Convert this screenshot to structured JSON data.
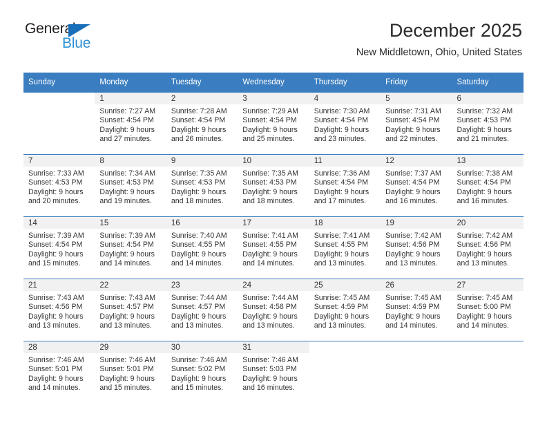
{
  "logo": {
    "word_one": "General",
    "word_two": "Blue",
    "triangle_color": "#1a6fba",
    "blue_text_color": "#2d8fd5"
  },
  "header": {
    "title": "December 2025",
    "subtitle": "New Middletown, Ohio, United States"
  },
  "theme": {
    "header_blue": "#3a7dc0",
    "daynum_band": "#f1f1f1",
    "text": "#333333"
  },
  "calendar": {
    "weekdays": [
      "Sunday",
      "Monday",
      "Tuesday",
      "Wednesday",
      "Thursday",
      "Friday",
      "Saturday"
    ],
    "weeks": [
      [
        {
          "day": "",
          "lines": []
        },
        {
          "day": "1",
          "lines": [
            "Sunrise: 7:27 AM",
            "Sunset: 4:54 PM",
            "Daylight: 9 hours",
            "and 27 minutes."
          ]
        },
        {
          "day": "2",
          "lines": [
            "Sunrise: 7:28 AM",
            "Sunset: 4:54 PM",
            "Daylight: 9 hours",
            "and 26 minutes."
          ]
        },
        {
          "day": "3",
          "lines": [
            "Sunrise: 7:29 AM",
            "Sunset: 4:54 PM",
            "Daylight: 9 hours",
            "and 25 minutes."
          ]
        },
        {
          "day": "4",
          "lines": [
            "Sunrise: 7:30 AM",
            "Sunset: 4:54 PM",
            "Daylight: 9 hours",
            "and 23 minutes."
          ]
        },
        {
          "day": "5",
          "lines": [
            "Sunrise: 7:31 AM",
            "Sunset: 4:54 PM",
            "Daylight: 9 hours",
            "and 22 minutes."
          ]
        },
        {
          "day": "6",
          "lines": [
            "Sunrise: 7:32 AM",
            "Sunset: 4:53 PM",
            "Daylight: 9 hours",
            "and 21 minutes."
          ]
        }
      ],
      [
        {
          "day": "7",
          "lines": [
            "Sunrise: 7:33 AM",
            "Sunset: 4:53 PM",
            "Daylight: 9 hours",
            "and 20 minutes."
          ]
        },
        {
          "day": "8",
          "lines": [
            "Sunrise: 7:34 AM",
            "Sunset: 4:53 PM",
            "Daylight: 9 hours",
            "and 19 minutes."
          ]
        },
        {
          "day": "9",
          "lines": [
            "Sunrise: 7:35 AM",
            "Sunset: 4:53 PM",
            "Daylight: 9 hours",
            "and 18 minutes."
          ]
        },
        {
          "day": "10",
          "lines": [
            "Sunrise: 7:35 AM",
            "Sunset: 4:53 PM",
            "Daylight: 9 hours",
            "and 18 minutes."
          ]
        },
        {
          "day": "11",
          "lines": [
            "Sunrise: 7:36 AM",
            "Sunset: 4:54 PM",
            "Daylight: 9 hours",
            "and 17 minutes."
          ]
        },
        {
          "day": "12",
          "lines": [
            "Sunrise: 7:37 AM",
            "Sunset: 4:54 PM",
            "Daylight: 9 hours",
            "and 16 minutes."
          ]
        },
        {
          "day": "13",
          "lines": [
            "Sunrise: 7:38 AM",
            "Sunset: 4:54 PM",
            "Daylight: 9 hours",
            "and 16 minutes."
          ]
        }
      ],
      [
        {
          "day": "14",
          "lines": [
            "Sunrise: 7:39 AM",
            "Sunset: 4:54 PM",
            "Daylight: 9 hours",
            "and 15 minutes."
          ]
        },
        {
          "day": "15",
          "lines": [
            "Sunrise: 7:39 AM",
            "Sunset: 4:54 PM",
            "Daylight: 9 hours",
            "and 14 minutes."
          ]
        },
        {
          "day": "16",
          "lines": [
            "Sunrise: 7:40 AM",
            "Sunset: 4:55 PM",
            "Daylight: 9 hours",
            "and 14 minutes."
          ]
        },
        {
          "day": "17",
          "lines": [
            "Sunrise: 7:41 AM",
            "Sunset: 4:55 PM",
            "Daylight: 9 hours",
            "and 14 minutes."
          ]
        },
        {
          "day": "18",
          "lines": [
            "Sunrise: 7:41 AM",
            "Sunset: 4:55 PM",
            "Daylight: 9 hours",
            "and 13 minutes."
          ]
        },
        {
          "day": "19",
          "lines": [
            "Sunrise: 7:42 AM",
            "Sunset: 4:56 PM",
            "Daylight: 9 hours",
            "and 13 minutes."
          ]
        },
        {
          "day": "20",
          "lines": [
            "Sunrise: 7:42 AM",
            "Sunset: 4:56 PM",
            "Daylight: 9 hours",
            "and 13 minutes."
          ]
        }
      ],
      [
        {
          "day": "21",
          "lines": [
            "Sunrise: 7:43 AM",
            "Sunset: 4:56 PM",
            "Daylight: 9 hours",
            "and 13 minutes."
          ]
        },
        {
          "day": "22",
          "lines": [
            "Sunrise: 7:43 AM",
            "Sunset: 4:57 PM",
            "Daylight: 9 hours",
            "and 13 minutes."
          ]
        },
        {
          "day": "23",
          "lines": [
            "Sunrise: 7:44 AM",
            "Sunset: 4:57 PM",
            "Daylight: 9 hours",
            "and 13 minutes."
          ]
        },
        {
          "day": "24",
          "lines": [
            "Sunrise: 7:44 AM",
            "Sunset: 4:58 PM",
            "Daylight: 9 hours",
            "and 13 minutes."
          ]
        },
        {
          "day": "25",
          "lines": [
            "Sunrise: 7:45 AM",
            "Sunset: 4:59 PM",
            "Daylight: 9 hours",
            "and 13 minutes."
          ]
        },
        {
          "day": "26",
          "lines": [
            "Sunrise: 7:45 AM",
            "Sunset: 4:59 PM",
            "Daylight: 9 hours",
            "and 14 minutes."
          ]
        },
        {
          "day": "27",
          "lines": [
            "Sunrise: 7:45 AM",
            "Sunset: 5:00 PM",
            "Daylight: 9 hours",
            "and 14 minutes."
          ]
        }
      ],
      [
        {
          "day": "28",
          "lines": [
            "Sunrise: 7:46 AM",
            "Sunset: 5:01 PM",
            "Daylight: 9 hours",
            "and 14 minutes."
          ]
        },
        {
          "day": "29",
          "lines": [
            "Sunrise: 7:46 AM",
            "Sunset: 5:01 PM",
            "Daylight: 9 hours",
            "and 15 minutes."
          ]
        },
        {
          "day": "30",
          "lines": [
            "Sunrise: 7:46 AM",
            "Sunset: 5:02 PM",
            "Daylight: 9 hours",
            "and 15 minutes."
          ]
        },
        {
          "day": "31",
          "lines": [
            "Sunrise: 7:46 AM",
            "Sunset: 5:03 PM",
            "Daylight: 9 hours",
            "and 16 minutes."
          ]
        },
        {
          "day": "",
          "lines": []
        },
        {
          "day": "",
          "lines": []
        },
        {
          "day": "",
          "lines": []
        }
      ]
    ]
  }
}
